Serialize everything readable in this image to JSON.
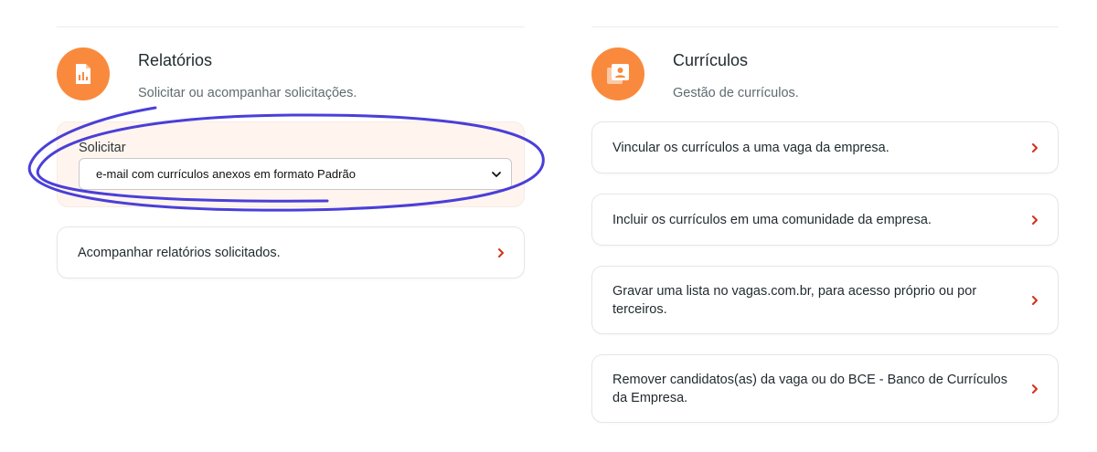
{
  "reports": {
    "title": "Relatórios",
    "subtitle": "Solicitar ou acompanhar solicitações.",
    "icon": "report-chart-icon",
    "request_label": "Solicitar",
    "request_select_value": "e-mail com currículos anexos em formato Padrão",
    "follow_label": "Acompanhar relatórios solicitados."
  },
  "resumes": {
    "title": "Currículos",
    "subtitle": "Gestão de currículos.",
    "icon": "resume-contact-icon",
    "items": [
      {
        "label": "Vincular os currículos a uma vaga da empresa."
      },
      {
        "label": "Incluir os currículos em uma comunidade da empresa."
      },
      {
        "label": "Gravar uma lista no vagas.com.br, para acesso próprio ou por terceiros."
      },
      {
        "label": "Remover candidatos(as) da vaga ou do BCE - Banco de Currículos da Empresa."
      }
    ]
  },
  "colors": {
    "accent_orange": "#f98a3d",
    "chevron_red": "#d4301a",
    "annotation_blue": "#3b2fd6",
    "request_box_bg": "#fff5ee"
  }
}
